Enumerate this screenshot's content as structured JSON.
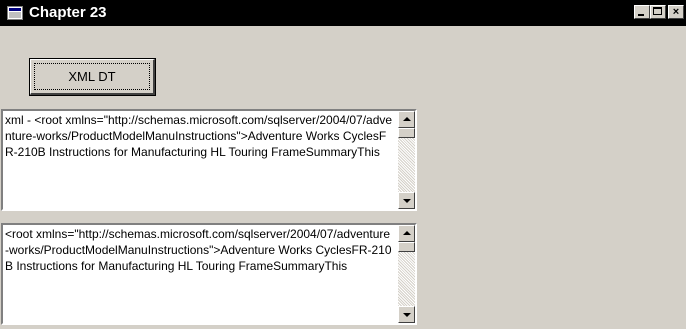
{
  "window": {
    "title": "Chapter 23",
    "icon": "app-window-icon",
    "caption_buttons": {
      "minimize": "minimize-icon",
      "maximize": "maximize-icon",
      "close": "close-icon",
      "close_glyph": "×"
    }
  },
  "toolbar": {
    "xml_dt_label": "XML DT"
  },
  "textboxes": [
    {
      "value": "xml - <root xmlns=\"http://schemas.microsoft.com/sqlserver/2004/07/adventure-works/ProductModelManuInstructions\">Adventure Works CyclesFR-210B Instructions for Manufacturing HL Touring FrameSummaryThis"
    },
    {
      "value": "<root xmlns=\"http://schemas.microsoft.com/sqlserver/2004/07/adventure-works/ProductModelManuInstructions\">Adventure Works CyclesFR-210B Instructions for Manufacturing HL Touring FrameSummaryThis"
    }
  ],
  "colors": {
    "face": "#d4d0c8",
    "titlebar": "#000000",
    "title_text": "#ffffff",
    "textbox_bg": "#ffffff"
  }
}
